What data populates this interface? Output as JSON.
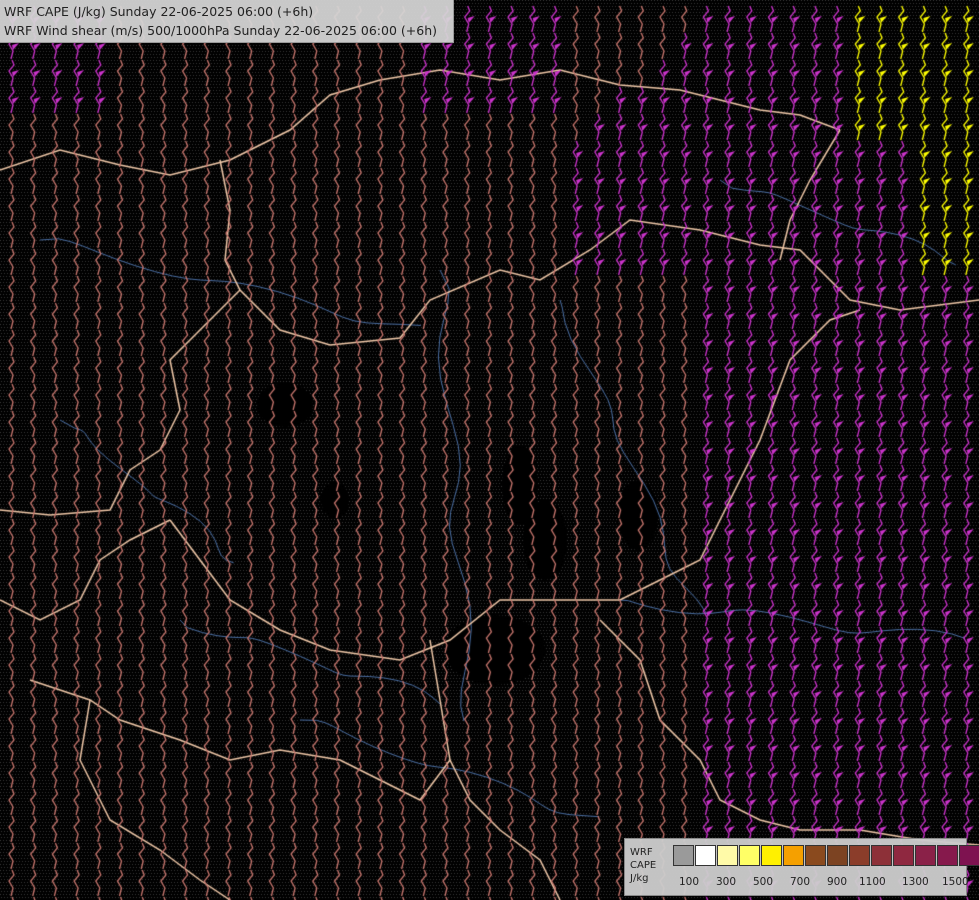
{
  "header": {
    "line1": "WRF CAPE (J/kg) Sunday 22-06-2025 06:00 (+6h)",
    "line2": "WRF Wind shear (m/s) 500/1000hPa Sunday 22-06-2025 06:00 (+6h)"
  },
  "legend": {
    "label_lines": [
      "WRF",
      "CAPE",
      "J/kg"
    ],
    "swatch_colors": [
      "#9a9a9a",
      "#ffffff",
      "#fffaa8",
      "#ffff66",
      "#fff000",
      "#f5a000",
      "#8a4a1e",
      "#7c4322",
      "#8b3d2a",
      "#8d3038",
      "#8f2840",
      "#8a2148",
      "#86194c",
      "#7e1250",
      "#760c55",
      "#6e0858"
    ],
    "tick_labels": [
      "100",
      "300",
      "500",
      "700",
      "900",
      "1100",
      "1300",
      "1500"
    ]
  },
  "colors": {
    "background": "#000000",
    "shear_moderate": "#c8766e",
    "shear_high": "#cc33cc",
    "shear_very_high": "#ffff00",
    "borders": "#f0c8a8",
    "rivers": "#4a6fa5"
  }
}
